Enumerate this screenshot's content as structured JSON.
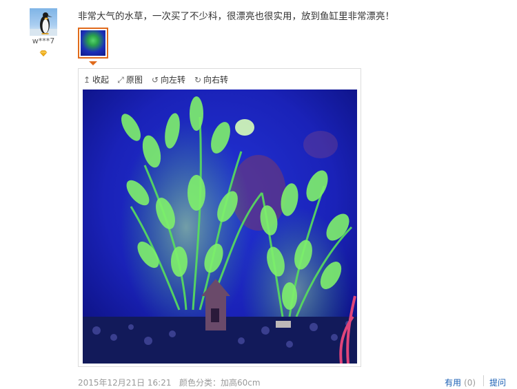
{
  "user": {
    "name": "w***7",
    "badge_icon": "diamond-icon",
    "avatar_icon": "penguin-avatar"
  },
  "review": {
    "text": "非常大气的水草，一次买了不少科，很漂亮也很实用，放到鱼缸里非常漂亮！"
  },
  "viewer": {
    "collapse_label": "收起",
    "original_label": "原图",
    "rotate_left_label": "向左转",
    "rotate_right_label": "向右转"
  },
  "footer": {
    "date": "2015年12月21日 16:21",
    "variant": "颜色分类：加高60cm",
    "useful_label": "有用",
    "useful_count": "(0)",
    "ask_label": "提问"
  },
  "colors": {
    "thumb_border": "#e06a1b",
    "link": "#1a5fb4",
    "muted": "#999999",
    "vip_badge": "#f2b21e"
  }
}
